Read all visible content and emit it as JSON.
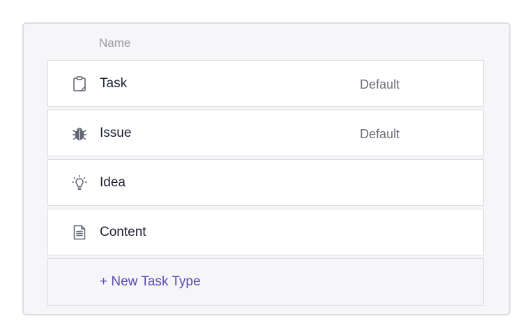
{
  "table": {
    "column_header": "Name",
    "rows": [
      {
        "icon": "clipboard-icon",
        "label": "Task",
        "badge": "Default"
      },
      {
        "icon": "bug-icon",
        "label": "Issue",
        "badge": "Default"
      },
      {
        "icon": "lightbulb-icon",
        "label": "Idea",
        "badge": ""
      },
      {
        "icon": "document-icon",
        "label": "Content",
        "badge": ""
      }
    ],
    "new_label": "+ New Task Type"
  },
  "colors": {
    "icon": "#5f6470",
    "link": "#5b4bb7",
    "panel_bg": "#f6f6f8",
    "border": "#dcdce2"
  }
}
